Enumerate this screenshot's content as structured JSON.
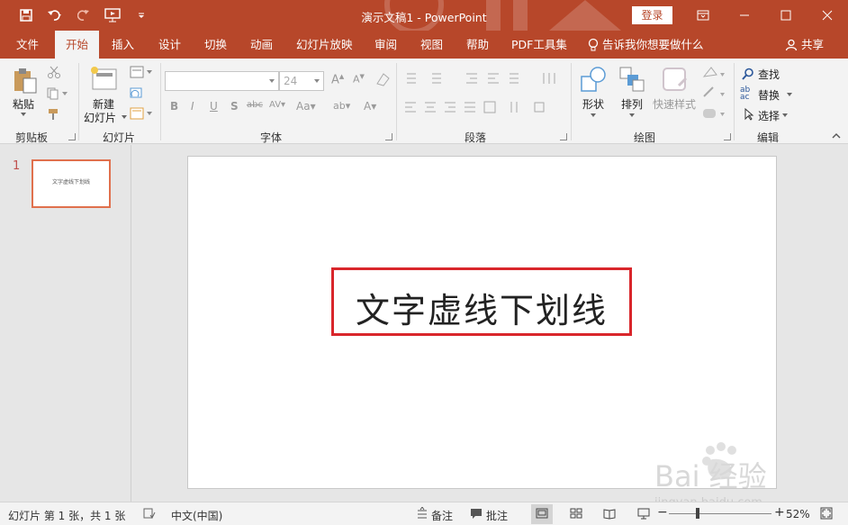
{
  "title_bar": {
    "title": "演示文稿1 - PowerPoint",
    "login": "登录",
    "qat": [
      "save-icon",
      "undo-icon",
      "redo-icon",
      "present-icon",
      "customize-icon"
    ]
  },
  "tabs": [
    {
      "label": "文件",
      "active": false
    },
    {
      "label": "开始",
      "active": true
    },
    {
      "label": "插入",
      "active": false
    },
    {
      "label": "设计",
      "active": false
    },
    {
      "label": "切换",
      "active": false
    },
    {
      "label": "动画",
      "active": false
    },
    {
      "label": "幻灯片放映",
      "active": false
    },
    {
      "label": "审阅",
      "active": false
    },
    {
      "label": "视图",
      "active": false
    },
    {
      "label": "帮助",
      "active": false
    },
    {
      "label": "PDF工具集",
      "active": false
    }
  ],
  "tell_me": "告诉我你想要做什么",
  "share": "共享",
  "ribbon": {
    "clipboard": {
      "group": "剪贴板",
      "paste": "粘贴"
    },
    "slides": {
      "group": "幻灯片",
      "new_slide_1": "新建",
      "new_slide_2": "幻灯片"
    },
    "font": {
      "group": "字体",
      "font_size": "24"
    },
    "paragraph": {
      "group": "段落"
    },
    "drawing": {
      "group": "绘图",
      "shapes": "形状",
      "arrange": "排列",
      "quick_styles": "快速样式"
    },
    "editing": {
      "group": "编辑",
      "find": "查找",
      "replace": "替换",
      "select": "选择"
    }
  },
  "thumbnails": [
    {
      "number": "1",
      "text": "文字虚线下划线"
    }
  ],
  "slide": {
    "title": "文字虚线下划线",
    "highlight_color": "#d9262b"
  },
  "status": {
    "slide_info": "幻灯片 第 1 张，共 1 张",
    "language": "中文(中国)",
    "notes": "备注",
    "comments": "批注",
    "zoom": "52%",
    "zoom_percent": 52
  },
  "watermark": {
    "brand": "Bai 经验",
    "url": "jingyan.baidu.com"
  },
  "colors": {
    "accent": "#b7472a",
    "ribbon_bg": "#f3f3f3"
  }
}
